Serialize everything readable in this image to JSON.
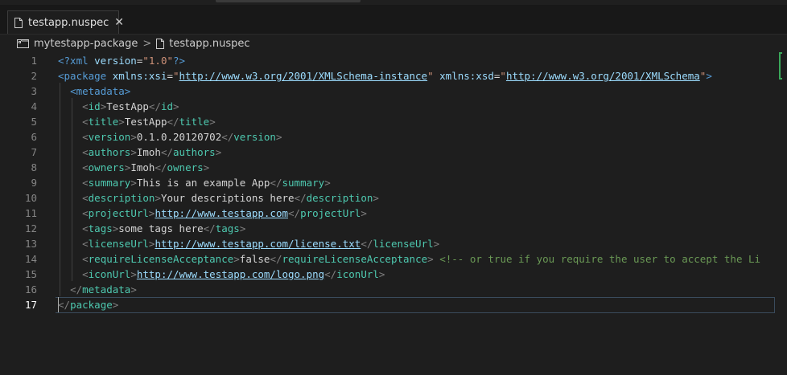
{
  "tab": {
    "label": "testapp.nuspec",
    "close": "✕"
  },
  "breadcrumb": {
    "folder": "mytestapp-package",
    "separator": ">",
    "file": "testapp.nuspec"
  },
  "editor": {
    "current_line": 17,
    "lines": [
      {
        "n": "1",
        "tokens": [
          {
            "c": "t",
            "v": "<?xml "
          },
          {
            "c": "a",
            "v": "version"
          },
          {
            "c": "txt",
            "v": "="
          },
          {
            "c": "s",
            "v": "\"1.0\""
          },
          {
            "c": "t",
            "v": "?>"
          }
        ]
      },
      {
        "n": "2",
        "tokens": [
          {
            "c": "t",
            "v": "<package "
          },
          {
            "c": "a",
            "v": "xmlns:xsi"
          },
          {
            "c": "txt",
            "v": "="
          },
          {
            "c": "s",
            "v": "\""
          },
          {
            "c": "u",
            "v": "http://www.w3.org/2001/XMLSchema-instance"
          },
          {
            "c": "s",
            "v": "\""
          },
          {
            "c": "txt",
            "v": " "
          },
          {
            "c": "a",
            "v": "xmlns:xsd"
          },
          {
            "c": "txt",
            "v": "="
          },
          {
            "c": "s",
            "v": "\""
          },
          {
            "c": "u",
            "v": "http://www.w3.org/2001/XMLSchema"
          },
          {
            "c": "s",
            "v": "\""
          },
          {
            "c": "t",
            "v": ">"
          }
        ]
      },
      {
        "n": "3",
        "tokens": [
          {
            "c": "txt",
            "v": "  "
          },
          {
            "c": "t",
            "v": "<metadata>"
          }
        ]
      },
      {
        "n": "4",
        "tokens": [
          {
            "c": "txt",
            "v": "    "
          },
          {
            "c": "p",
            "v": "<"
          },
          {
            "c": "b",
            "v": "id"
          },
          {
            "c": "p",
            "v": ">"
          },
          {
            "c": "txt",
            "v": "TestApp"
          },
          {
            "c": "p",
            "v": "</"
          },
          {
            "c": "b",
            "v": "id"
          },
          {
            "c": "p",
            "v": ">"
          }
        ]
      },
      {
        "n": "5",
        "tokens": [
          {
            "c": "txt",
            "v": "    "
          },
          {
            "c": "p",
            "v": "<"
          },
          {
            "c": "b",
            "v": "title"
          },
          {
            "c": "p",
            "v": ">"
          },
          {
            "c": "txt",
            "v": "TestApp"
          },
          {
            "c": "p",
            "v": "</"
          },
          {
            "c": "b",
            "v": "title"
          },
          {
            "c": "p",
            "v": ">"
          }
        ]
      },
      {
        "n": "6",
        "tokens": [
          {
            "c": "txt",
            "v": "    "
          },
          {
            "c": "p",
            "v": "<"
          },
          {
            "c": "b",
            "v": "version"
          },
          {
            "c": "p",
            "v": ">"
          },
          {
            "c": "txt",
            "v": "0.1.0.20120702"
          },
          {
            "c": "p",
            "v": "</"
          },
          {
            "c": "b",
            "v": "version"
          },
          {
            "c": "p",
            "v": ">"
          }
        ]
      },
      {
        "n": "7",
        "tokens": [
          {
            "c": "txt",
            "v": "    "
          },
          {
            "c": "p",
            "v": "<"
          },
          {
            "c": "b",
            "v": "authors"
          },
          {
            "c": "p",
            "v": ">"
          },
          {
            "c": "txt",
            "v": "Imoh"
          },
          {
            "c": "p",
            "v": "</"
          },
          {
            "c": "b",
            "v": "authors"
          },
          {
            "c": "p",
            "v": ">"
          }
        ]
      },
      {
        "n": "8",
        "tokens": [
          {
            "c": "txt",
            "v": "    "
          },
          {
            "c": "p",
            "v": "<"
          },
          {
            "c": "b",
            "v": "owners"
          },
          {
            "c": "p",
            "v": ">"
          },
          {
            "c": "txt",
            "v": "Imoh"
          },
          {
            "c": "p",
            "v": "</"
          },
          {
            "c": "b",
            "v": "owners"
          },
          {
            "c": "p",
            "v": ">"
          }
        ]
      },
      {
        "n": "9",
        "tokens": [
          {
            "c": "txt",
            "v": "    "
          },
          {
            "c": "p",
            "v": "<"
          },
          {
            "c": "b",
            "v": "summary"
          },
          {
            "c": "p",
            "v": ">"
          },
          {
            "c": "txt",
            "v": "This is an example App"
          },
          {
            "c": "p",
            "v": "</"
          },
          {
            "c": "b",
            "v": "summary"
          },
          {
            "c": "p",
            "v": ">"
          }
        ]
      },
      {
        "n": "10",
        "tokens": [
          {
            "c": "txt",
            "v": "    "
          },
          {
            "c": "p",
            "v": "<"
          },
          {
            "c": "b",
            "v": "description"
          },
          {
            "c": "p",
            "v": ">"
          },
          {
            "c": "txt",
            "v": "Your descriptions here"
          },
          {
            "c": "p",
            "v": "</"
          },
          {
            "c": "b",
            "v": "description"
          },
          {
            "c": "p",
            "v": ">"
          }
        ]
      },
      {
        "n": "11",
        "tokens": [
          {
            "c": "txt",
            "v": "    "
          },
          {
            "c": "p",
            "v": "<"
          },
          {
            "c": "b",
            "v": "projectUrl"
          },
          {
            "c": "p",
            "v": ">"
          },
          {
            "c": "u",
            "v": "http://www.testapp.com"
          },
          {
            "c": "p",
            "v": "</"
          },
          {
            "c": "b",
            "v": "projectUrl"
          },
          {
            "c": "p",
            "v": ">"
          }
        ]
      },
      {
        "n": "12",
        "tokens": [
          {
            "c": "txt",
            "v": "    "
          },
          {
            "c": "p",
            "v": "<"
          },
          {
            "c": "b",
            "v": "tags"
          },
          {
            "c": "p",
            "v": ">"
          },
          {
            "c": "txt",
            "v": "some tags here"
          },
          {
            "c": "p",
            "v": "</"
          },
          {
            "c": "b",
            "v": "tags"
          },
          {
            "c": "p",
            "v": ">"
          }
        ]
      },
      {
        "n": "13",
        "tokens": [
          {
            "c": "txt",
            "v": "    "
          },
          {
            "c": "p",
            "v": "<"
          },
          {
            "c": "b",
            "v": "licenseUrl"
          },
          {
            "c": "p",
            "v": ">"
          },
          {
            "c": "u",
            "v": "http://www.testapp.com/license.txt"
          },
          {
            "c": "p",
            "v": "</"
          },
          {
            "c": "b",
            "v": "licenseUrl"
          },
          {
            "c": "p",
            "v": ">"
          }
        ]
      },
      {
        "n": "14",
        "tokens": [
          {
            "c": "txt",
            "v": "    "
          },
          {
            "c": "p",
            "v": "<"
          },
          {
            "c": "b",
            "v": "requireLicenseAcceptance"
          },
          {
            "c": "p",
            "v": ">"
          },
          {
            "c": "txt",
            "v": "false"
          },
          {
            "c": "p",
            "v": "</"
          },
          {
            "c": "b",
            "v": "requireLicenseAcceptance"
          },
          {
            "c": "p",
            "v": ">"
          },
          {
            "c": "txt",
            "v": " "
          },
          {
            "c": "cm",
            "v": "<!-- or true if you require the user to accept the Li"
          }
        ]
      },
      {
        "n": "15",
        "tokens": [
          {
            "c": "txt",
            "v": "    "
          },
          {
            "c": "p",
            "v": "<"
          },
          {
            "c": "b",
            "v": "iconUrl"
          },
          {
            "c": "p",
            "v": ">"
          },
          {
            "c": "u",
            "v": "http://www.testapp.com/logo.png"
          },
          {
            "c": "p",
            "v": "</"
          },
          {
            "c": "b",
            "v": "iconUrl"
          },
          {
            "c": "p",
            "v": ">"
          }
        ]
      },
      {
        "n": "16",
        "tokens": [
          {
            "c": "txt",
            "v": "  "
          },
          {
            "c": "p",
            "v": "</"
          },
          {
            "c": "b",
            "v": "metadata"
          },
          {
            "c": "p",
            "v": ">"
          }
        ]
      },
      {
        "n": "17",
        "tokens": [
          {
            "c": "p",
            "v": "</"
          },
          {
            "c": "b",
            "v": "package"
          },
          {
            "c": "p",
            "v": ">"
          }
        ]
      }
    ]
  },
  "colors": {
    "background": "#1e1e1e",
    "tag": "#569cd6",
    "element_name": "#4ec9b0",
    "attribute": "#9cdcfe",
    "string": "#ce9178",
    "comment": "#6a9955",
    "minimap_marker": "#3aa75a"
  },
  "icons": {
    "tab_file": "file-icon",
    "breadcrumb_folder": "folder-icon",
    "breadcrumb_file": "file-icon",
    "tab_close": "close-icon"
  }
}
